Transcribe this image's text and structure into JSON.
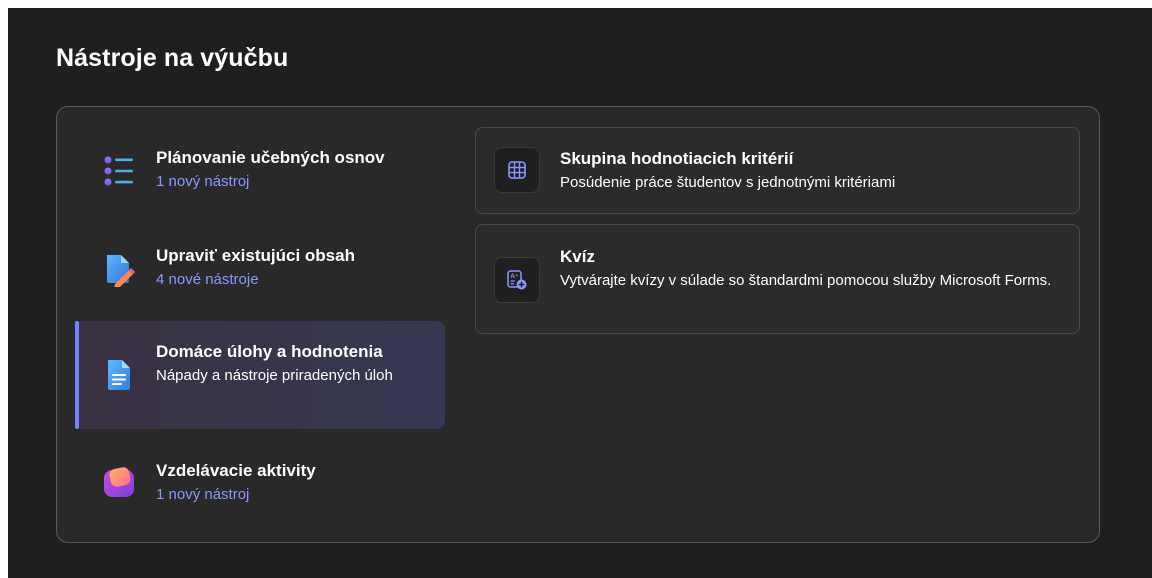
{
  "page_title": "Nástroje na výučbu",
  "colors": {
    "background": "#1f1f1f",
    "panel": "#292929",
    "accent": "#7482ff",
    "link": "#8b99ff"
  },
  "categories": [
    {
      "title": "Plánovanie učebných osnov",
      "subtitle": "1 nový nástroj",
      "icon": "list-icon",
      "active": false
    },
    {
      "title": "Upraviť existujúci obsah",
      "subtitle": "4 nové nástroje",
      "icon": "edit-document-icon",
      "active": false
    },
    {
      "title": "Domáce úlohy a hodnotenia",
      "subtitle": "Nápady a nástroje priradených úloh",
      "icon": "document-icon",
      "active": true
    },
    {
      "title": "Vzdelávacie aktivity",
      "subtitle": "1 nový nástroj",
      "icon": "activities-icon",
      "active": false
    }
  ],
  "tools": [
    {
      "title": "Skupina hodnotiacich kritérií",
      "description": "Posúdenie práce študentov s jednotnými kritériami",
      "icon": "grid-icon"
    },
    {
      "title": "Kvíz",
      "description": "Vytvárajte kvízy v súlade so štandardmi pomocou služby Microsoft Forms.",
      "icon": "quiz-add-icon"
    }
  ]
}
